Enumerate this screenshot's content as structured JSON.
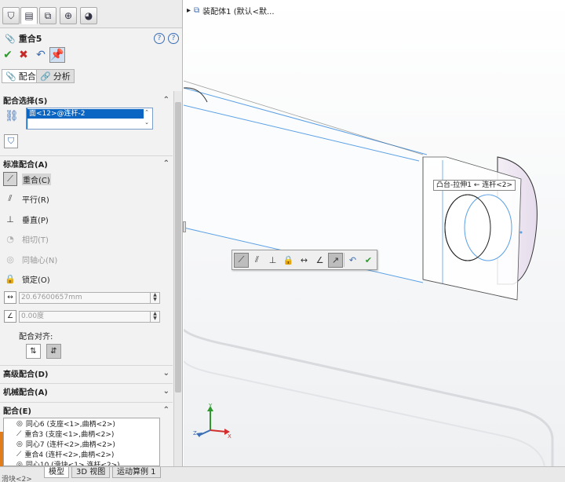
{
  "manager": {
    "title": "重合5",
    "tabs": {
      "mates": "配合",
      "analysis": "分析"
    },
    "sections": {
      "mate_selection": "配合选择(S)",
      "standard": "标准配合(A)",
      "advanced": "高级配合(D)",
      "mechanical": "机械配合(A)",
      "mates": "配合(E)"
    },
    "selection": {
      "entry": "面<12>@连杆-2"
    },
    "standard_mates": [
      {
        "label": "重合(C)",
        "icon": "coincident-icon",
        "glyph": "⟋",
        "state": "selected"
      },
      {
        "label": "平行(R)",
        "icon": "parallel-icon",
        "glyph": "⫽",
        "state": "normal"
      },
      {
        "label": "垂直(P)",
        "icon": "perpendicular-icon",
        "glyph": "⊥",
        "state": "normal"
      },
      {
        "label": "相切(T)",
        "icon": "tangent-icon",
        "glyph": "◔",
        "state": "disabled"
      },
      {
        "label": "同轴心(N)",
        "icon": "concentric-icon",
        "glyph": "◎",
        "state": "disabled"
      },
      {
        "label": "锁定(O)",
        "icon": "lock-icon",
        "glyph": "🔒",
        "state": "normal"
      }
    ],
    "distance_value": "20.67600657mm",
    "angle_value": "0.00度",
    "alignment_label": "配合对齐:",
    "mates_list": [
      {
        "label": "同心6 (支座<1>,曲柄<2>)",
        "icon": "concentric-icon",
        "glyph": "◎"
      },
      {
        "label": "重合3 (支座<1>,曲柄<2>)",
        "icon": "coincident-icon",
        "glyph": "⟋"
      },
      {
        "label": "同心7 (连杆<2>,曲柄<2>)",
        "icon": "concentric-icon",
        "glyph": "◎"
      },
      {
        "label": "重合4 (连杆<2>,曲柄<2>)",
        "icon": "coincident-icon",
        "glyph": "⟋"
      },
      {
        "label": "同心10 (滑块<1>,连杆<2>)",
        "icon": "concentric-icon",
        "glyph": "◎"
      }
    ]
  },
  "viewport": {
    "tree_root": "装配体1 (默认<默...",
    "tooltip": "凸台-拉伸1 ← 连杆<2>",
    "triad": {
      "x": "X",
      "y": "Y",
      "z": "Z"
    }
  },
  "bottom_tabs": [
    "模型",
    "3D 视图",
    "运动算例 1"
  ],
  "status_text": "滑块<2>",
  "colors": {
    "selection": "#0a66c2",
    "edge_highlight": "#5aa0e6",
    "ok_green": "#2e9a2e",
    "cancel_red": "#c62828"
  }
}
